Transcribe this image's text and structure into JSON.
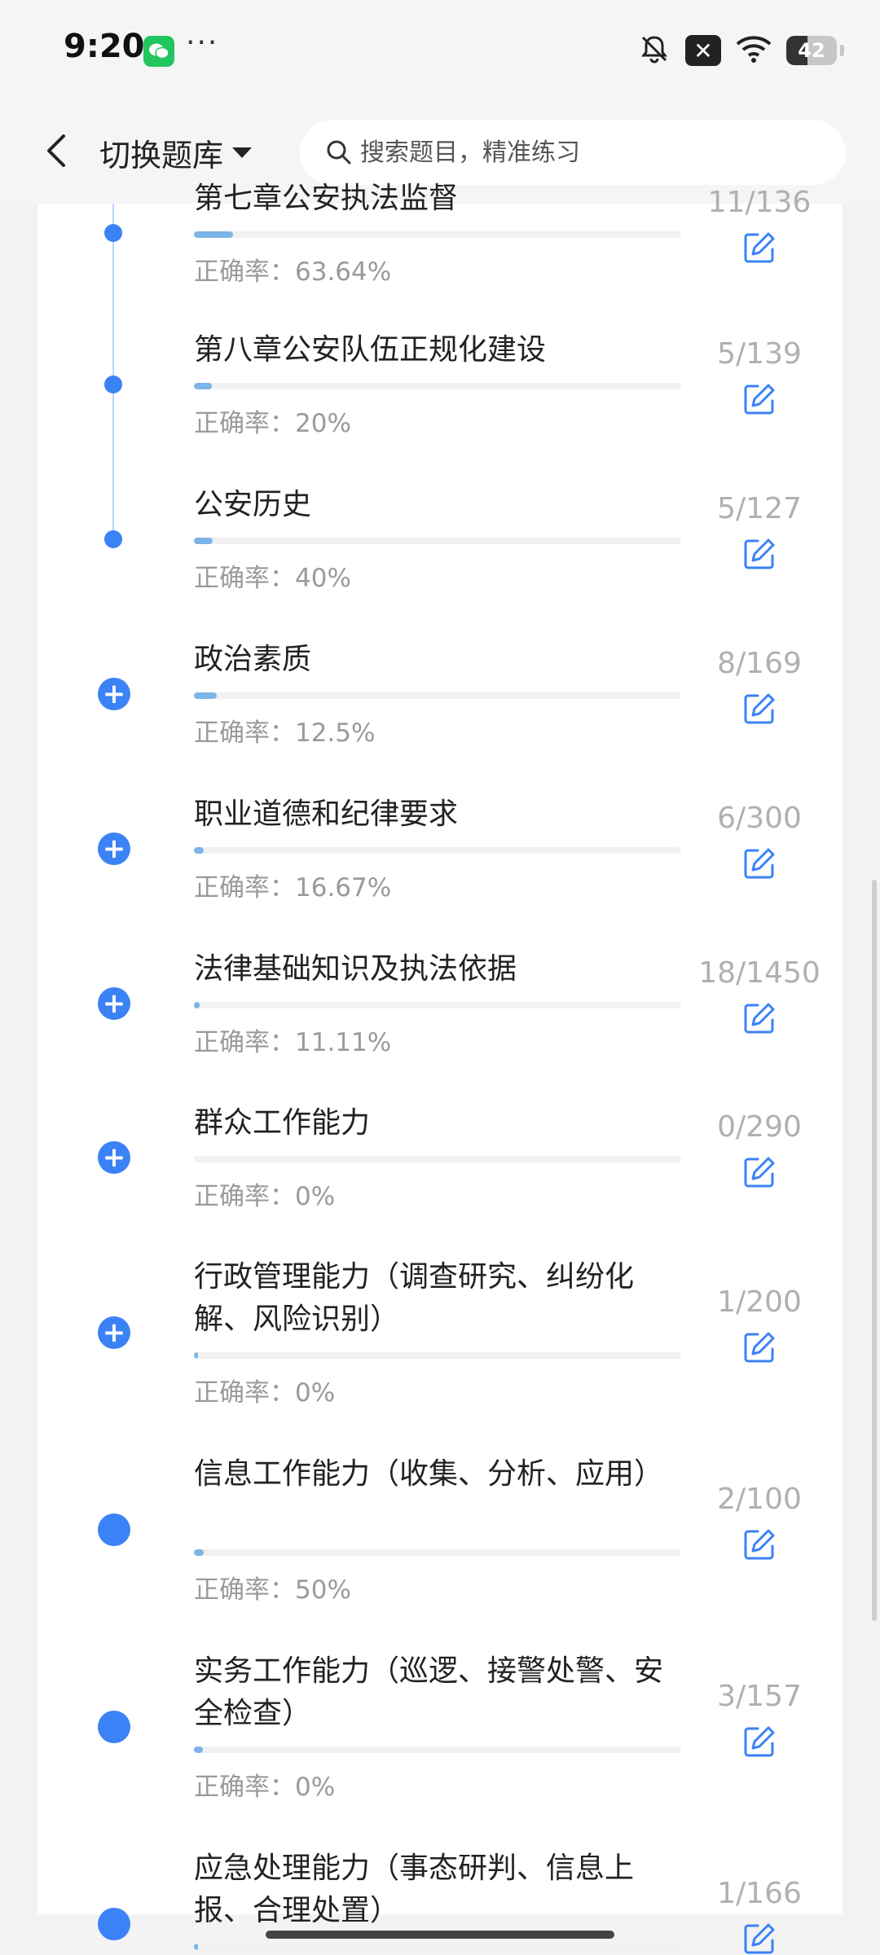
{
  "status_bar": {
    "time": "9:20",
    "overflow": "···",
    "battery": "42",
    "battery_level": 0.42,
    "icons": [
      "wechat-icon",
      "mute-icon",
      "close-badge-icon",
      "wifi-icon",
      "battery-icon"
    ]
  },
  "nav": {
    "switch_label": "切换题库",
    "search_placeholder": "搜索题目，精准练习"
  },
  "accent_color": "#3b82f6",
  "accuracy_prefix": "正确率：",
  "chapters": [
    {
      "title": "第七章公安执法监督",
      "accuracy": "正确率：63.64%",
      "count": "11/136",
      "progress": 0.08,
      "node": "dot"
    },
    {
      "title": "第八章公安队伍正规化建设",
      "accuracy": "正确率：20%",
      "count": "5/139",
      "progress": 0.036,
      "node": "dot"
    },
    {
      "title": "公安历史",
      "accuracy": "正确率：40%",
      "count": "5/127",
      "progress": 0.039,
      "node": "dot"
    },
    {
      "title": "政治素质",
      "accuracy": "正确率：12.5%",
      "count": "8/169",
      "progress": 0.047,
      "node": "plus"
    },
    {
      "title": "职业道德和纪律要求",
      "accuracy": "正确率：16.67%",
      "count": "6/300",
      "progress": 0.02,
      "node": "plus"
    },
    {
      "title": "法律基础知识及执法依据",
      "accuracy": "正确率：11.11%",
      "count": "18/1450",
      "progress": 0.012,
      "node": "plus"
    },
    {
      "title": "群众工作能力",
      "accuracy": "正确率：0%",
      "count": "0/290",
      "progress": 0,
      "node": "plus"
    },
    {
      "title": "行政管理能力（调查研究、纠纷化解、风险识别）",
      "accuracy": "正确率：0%",
      "count": "1/200",
      "progress": 0.005,
      "node": "plus"
    },
    {
      "title": "信息工作能力（收集、分析、应用）",
      "accuracy": "正确率：50%",
      "count": "2/100",
      "progress": 0.02,
      "node": "big"
    },
    {
      "title": "实务工作能力（巡逻、接警处警、安全检查）",
      "accuracy": "正确率：0%",
      "count": "3/157",
      "progress": 0.019,
      "node": "big"
    },
    {
      "title": "应急处理能力（事态研判、信息上报、合理处置）",
      "accuracy": "",
      "count": "1/166",
      "progress": 0.006,
      "node": "big"
    }
  ]
}
